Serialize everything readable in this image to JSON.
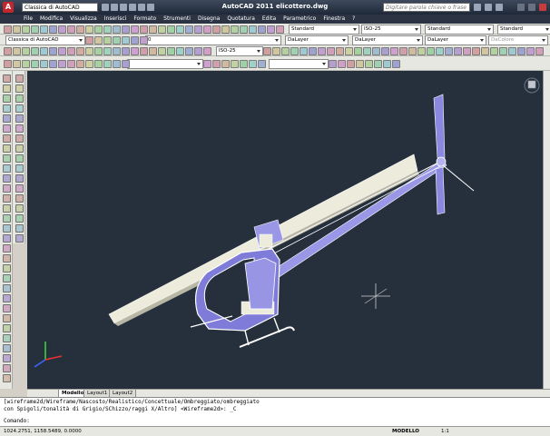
{
  "window": {
    "title": "AutoCAD 2011   elicottero.dwg",
    "workspace": "Classica di AutoCAD",
    "search_placeholder": "Digitare parola chiave o frase"
  },
  "menu": [
    "File",
    "Modifica",
    "Visualizza",
    "Inserisci",
    "Formato",
    "Strumenti",
    "Disegna",
    "Quotatura",
    "Edita",
    "Parametrico",
    "Finestra",
    "?"
  ],
  "toolbar1": {
    "text_style": "Standard",
    "dim_style": "ISO-25",
    "table_style": "Standard",
    "mleader_style": "Standard"
  },
  "toolbar2": {
    "workspace": "Classica di AutoCAD",
    "layer": "0",
    "color": "DaLayer",
    "linetype": "DaLayer",
    "lineweight": "DaLayer",
    "plotstyle": "DaColore"
  },
  "toolbar3": {
    "dim_style": "ISO-25"
  },
  "tabs": [
    "Modello",
    "Layout1",
    "Layout2"
  ],
  "command": {
    "line1": "[wireframe2d/Wireframe/Nascosto/Realistico/Concettuale/Ombreggiato/ombreggiato",
    "line2": "con Spigoli/tonalità di Grigio/SChizzo/raggi X/Altro] <Wireframe2d>: _C",
    "prompt": "Comando:"
  },
  "status": {
    "coords": "1024.2751, 1158.5489, 0.0000",
    "mode": "MODELLO",
    "scale": "1:1"
  },
  "colors": {
    "canvas": "#26303c",
    "heli_body": "#8a88e0",
    "heli_outline": "#ffffff",
    "rotor": "#eeeedd"
  }
}
